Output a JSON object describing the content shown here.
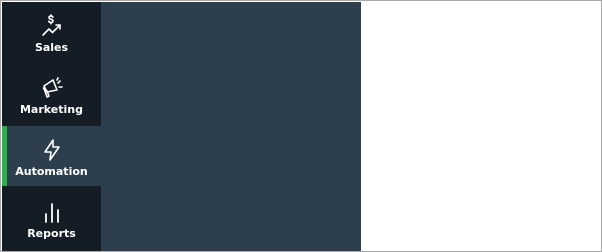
{
  "sidebar": {
    "items": [
      {
        "label": "Sales",
        "icon": "sales-icon",
        "active": false
      },
      {
        "label": "Marketing",
        "icon": "megaphone-icon",
        "active": false
      },
      {
        "label": "Automation",
        "icon": "lightning-icon",
        "active": true
      },
      {
        "label": "Reports",
        "icon": "bar-chart-icon",
        "active": false
      }
    ],
    "active_indicator_color": "#2fae4c"
  },
  "colors": {
    "rail_background": "#141c25",
    "panel_background": "#2d3e4d",
    "content_background": "#ffffff"
  }
}
